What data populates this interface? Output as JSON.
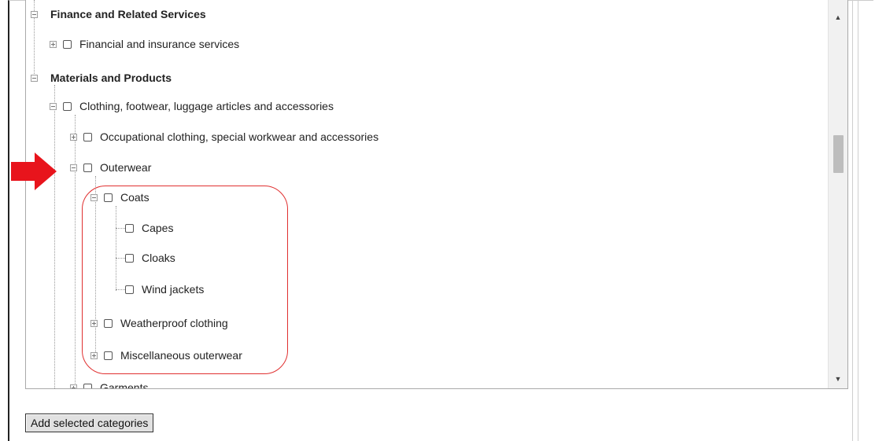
{
  "tree": {
    "groups": [
      {
        "label": "Finance and Related Services",
        "expanded": true
      },
      {
        "label": "Materials and Products",
        "expanded": true
      }
    ],
    "items": [
      {
        "label": "Financial and insurance services",
        "checked": false
      },
      {
        "label": "Clothing, footwear, luggage articles and accessories",
        "checked": false
      },
      {
        "label": "Occupational clothing, special workwear and accessories",
        "checked": false
      },
      {
        "label": "Outerwear",
        "checked": false
      },
      {
        "label": "Coats",
        "checked": false
      },
      {
        "label": "Capes",
        "checked": false
      },
      {
        "label": "Cloaks",
        "checked": false
      },
      {
        "label": "Wind jackets",
        "checked": false
      },
      {
        "label": "Weatherproof clothing",
        "checked": false
      },
      {
        "label": "Miscellaneous outerwear",
        "checked": false
      },
      {
        "label": "Garments",
        "checked": false
      }
    ]
  },
  "button": {
    "add_label": "Add selected categories"
  },
  "annotations": {
    "arrow_color": "#e8141c",
    "highlight_color": "#e03030"
  }
}
